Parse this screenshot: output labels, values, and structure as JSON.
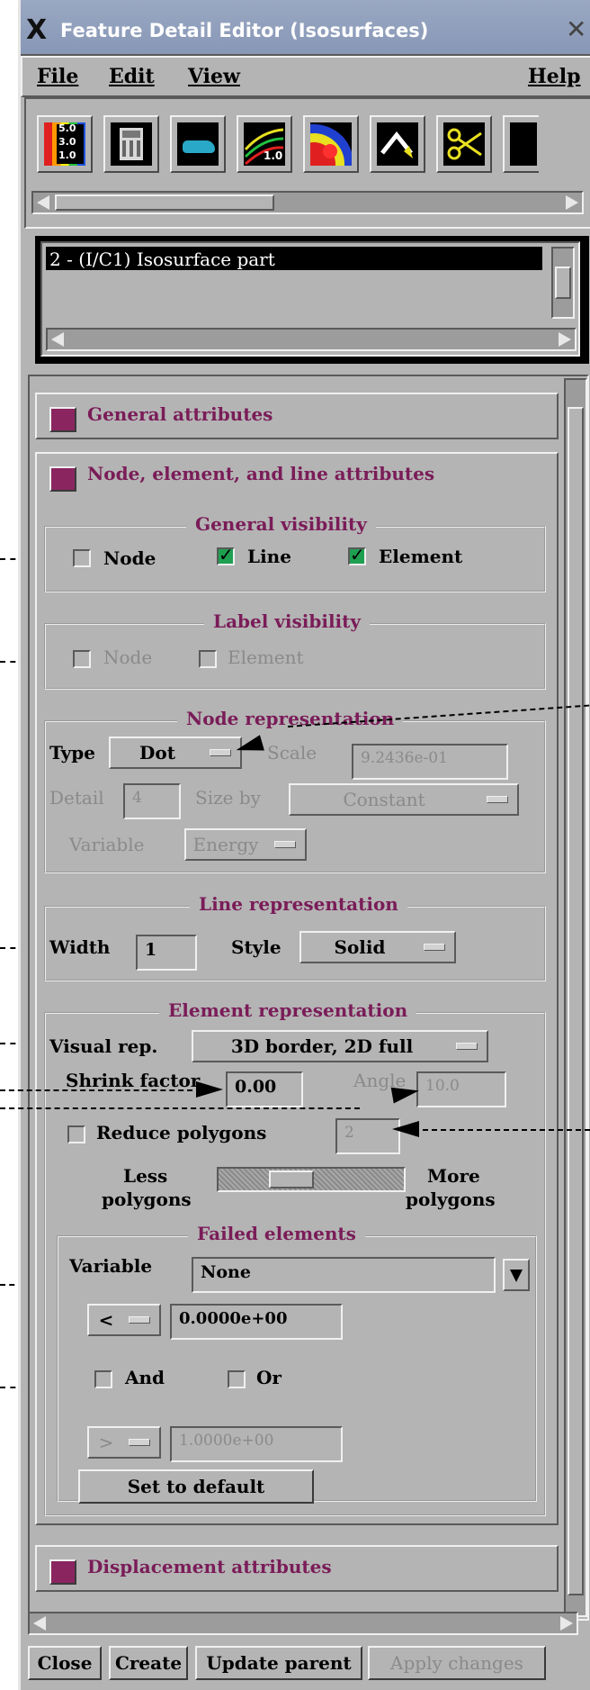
{
  "window": {
    "title": "Feature Detail Editor (Isosurfaces)"
  },
  "menubar": {
    "file": "File",
    "edit": "Edit",
    "view": "View",
    "help": "Help"
  },
  "toolbar": {
    "icons": [
      "color-legend-icon",
      "calculator-icon",
      "car-model-icon",
      "contour-icon",
      "isosurface-icon",
      "arrow-icon",
      "clip-scissors-icon"
    ],
    "legend_numbers": [
      "5.0",
      "3.0",
      "1.0"
    ],
    "contour_label": "1.0"
  },
  "parts": {
    "items": [
      "2 - (I/C1) Isosurface part"
    ]
  },
  "sections": {
    "general": "General attributes",
    "node_element": "Node, element, and line attributes",
    "displacement": "Displacement attributes"
  },
  "general_visibility": {
    "title": "General visibility",
    "node": "Node",
    "line": "Line",
    "element": "Element",
    "line_on": true,
    "element_on": true,
    "node_on": false
  },
  "label_visibility": {
    "title": "Label visibility",
    "node": "Node",
    "element": "Element"
  },
  "node_rep": {
    "title": "Node representation",
    "type_label": "Type",
    "type_value": "Dot",
    "scale_label": "Scale",
    "scale_value": "9.2436e-01",
    "detail_label": "Detail",
    "detail_value": "4",
    "sizeby_label": "Size by",
    "sizeby_value": "Constant",
    "variable_label": "Variable",
    "variable_value": "Energy"
  },
  "line_rep": {
    "title": "Line representation",
    "width_label": "Width",
    "width_value": "1",
    "style_label": "Style",
    "style_value": "Solid"
  },
  "element_rep": {
    "title": "Element representation",
    "visual_label": "Visual rep.",
    "visual_value": "3D border, 2D full",
    "shrink_label": "Shrink factor",
    "shrink_value": "0.00",
    "angle_label": "Angle",
    "angle_value": "10.0",
    "reduce_label": "Reduce polygons",
    "reduce_value": "2",
    "less_1": "Less",
    "less_2": "polygons",
    "more_1": "More",
    "more_2": "polygons",
    "slider_level": 0.36
  },
  "failed": {
    "title": "Failed elements",
    "variable_label": "Variable",
    "variable_value": "None",
    "op1": "<",
    "val1": "0.0000e+00",
    "and": "And",
    "or": "Or",
    "op2": ">",
    "val2": "1.0000e+00",
    "default_button": "Set to default"
  },
  "footer": {
    "close": "Close",
    "create": "Create",
    "update": "Update parent",
    "apply": "Apply changes"
  },
  "colors": {
    "accent": "#7a1c58",
    "toggle": "#8a2560",
    "check": "#1ea050",
    "bg": "#b4b4b4"
  }
}
